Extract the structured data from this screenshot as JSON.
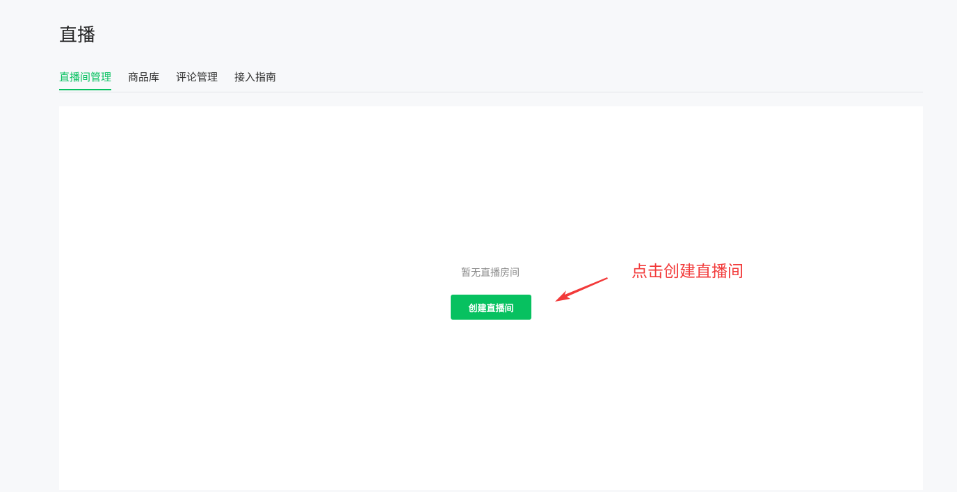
{
  "header": {
    "title": "直播"
  },
  "tabs": [
    {
      "label": "直播间管理",
      "active": true
    },
    {
      "label": "商品库",
      "active": false
    },
    {
      "label": "评论管理",
      "active": false
    },
    {
      "label": "接入指南",
      "active": false
    }
  ],
  "main": {
    "empty_text": "暂无直播房间",
    "create_button_label": "创建直播间"
  },
  "annotation": {
    "text": "点击创建直播间",
    "color": "#f23a3a"
  },
  "colors": {
    "accent": "#07c160",
    "background": "#f7f8fa",
    "panel": "#ffffff"
  }
}
